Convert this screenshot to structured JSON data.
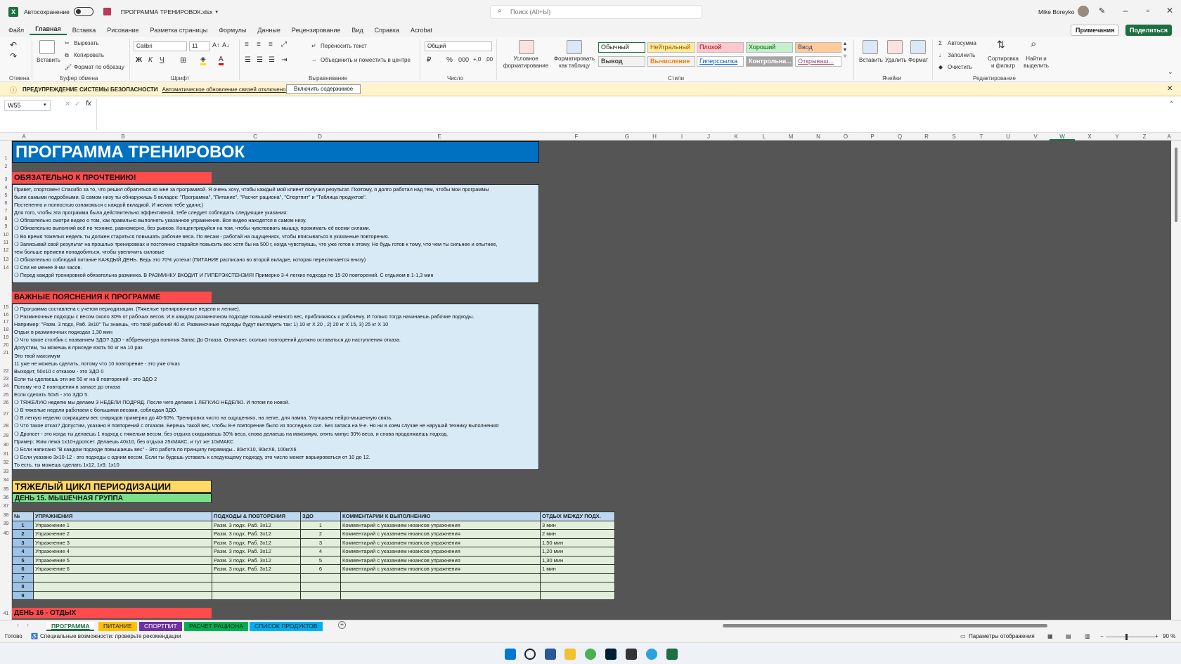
{
  "titlebar": {
    "autosave_label": "Автосохранение",
    "file_name": "ПРОГРАММА ТРЕНИРОВОК.xlsx",
    "search_placeholder": "Поиск (Alt+Ы)",
    "user_name": "Mike Boreyko"
  },
  "menu": {
    "tabs": [
      "Файл",
      "Главная",
      "Вставка",
      "Рисование",
      "Разметка страницы",
      "Формулы",
      "Данные",
      "Рецензирование",
      "Вид",
      "Справка",
      "Acrobat"
    ],
    "active_tab": "Главная",
    "comments": "Примечания",
    "share": "Поделиться"
  },
  "ribbon": {
    "groups": {
      "undo": "Отмена",
      "clipboard": "Буфер обмена",
      "font": "Шрифт",
      "alignment": "Выравнивание",
      "number": "Число",
      "styles": "Стили",
      "cells": "Ячейки",
      "editing": "Редактирование"
    },
    "paste": "Вставить",
    "cut": "Вырезать",
    "copy": "Копировать",
    "format_painter": "Формат по образцу",
    "font_name": "Calibri",
    "font_size": "11",
    "wrap_text": "Переносить текст",
    "merge_center": "Объединить и поместить в центре",
    "number_format": "Общий",
    "cond_format": "Условное форматирование",
    "format_table": "Форматировать как таблицу",
    "styles": [
      "Обычный",
      "Нейтральный",
      "Плохой",
      "Хороший",
      "Ввод",
      "Вывод",
      "Вычисление",
      "Гиперссылка",
      "Контрольна...",
      "Открываш..."
    ],
    "insert": "Вставить",
    "delete": "Удалить",
    "format": "Формат",
    "autosum": "Автосумма",
    "fill": "Заполнить",
    "clear": "Очистить",
    "sort_filter": "Сортировка и фильтр",
    "find_select": "Найти и выделить"
  },
  "warning": {
    "title": "ПРЕДУПРЕЖДЕНИЕ СИСТЕМЫ БЕЗОПАСНОСТИ",
    "message": "Автоматическое обновление связей отключено",
    "button": "Включить содержимое"
  },
  "formula_bar": {
    "name_box": "W55",
    "fx": "fx"
  },
  "columns": [
    "A",
    "B",
    "C",
    "D",
    "E",
    "F",
    "G",
    "H",
    "I",
    "J",
    "K",
    "L",
    "M",
    "N",
    "O",
    "P",
    "Q",
    "R",
    "S",
    "T",
    "U",
    "V",
    "W",
    "X",
    "Y",
    "Z",
    "A"
  ],
  "rows": [
    "1",
    "2",
    "3",
    "4",
    "5",
    "6",
    "7",
    "8",
    "9",
    "10",
    "11",
    "12",
    "13",
    "14",
    "15",
    "16",
    "17",
    "18",
    "19",
    "20",
    "21",
    "22",
    "23",
    "24",
    "25",
    "26",
    "27",
    "28",
    "29",
    "30",
    "31",
    "32",
    "33",
    "34",
    "35",
    "36",
    "37",
    "38",
    "39",
    "40",
    "41"
  ],
  "sheet": {
    "title": "ПРОГРАММА ТРЕНИРОВОК",
    "must_read": "ОБЯЗАТЕЛЬНО К ПРОЧТЕНИЮ!",
    "intro_lines": [
      "Привет, спортсмен! Спасибо за то, что решил обратиться ко мне за программой. Я очень хочу, чтобы каждый мой клиент получил результат. Поэтому, я долго работал над тем, чтобы мои программы",
      "были самыми подробными. В самом низу ты обнаружишь 5 вкладок: \"Программа\", \"Питание\", \"Расчет рациона\", \"Спортпит\" и \"Таблица продуктов\".",
      "Постепенно и полностью ознакомься с каждой вкладкой. И желаю тебе удачи;)",
      "Для того, чтобы эта программа была действительно эффективной, тебе следует соблюдать следующие указания:",
      "❍ Обязательно смотри видео о том, как правильно выполнять указанное упражнение. Все видео находятся в самом низу.",
      "❍ Обязательно выполняй всё по технике, равномерно, без рывков. Концентрируйся на том, чтобы чувствовать мышцу, прожимать её всеми силами.",
      "❍ Во время тяжелых недель ты должен стараться повышать рабочие веса. По весам - работай на ощущениях, чтобы вписываться в указанные повторения.",
      "❍ Записывай свой результат на прошлых тренировках и постоянно старайся повысить вес хотя бы на 500 г, когда чувствуешь, что уже готов к этому. Но будь готов к тому, что чем ты сильнее и опытнее,",
      "тем больше времени понадобиться, чтобы увеличить силовые",
      "❍ Обязательно соблюдай питание КАЖДЫЙ ДЕНЬ. Ведь это 70% успеха! (ПИТАНИЕ расписано во второй вкладке, которая переключается внизу)",
      "❍ Спи не менее 8-ми часов.",
      "❍ Перед каждой тренировкой обязательна разминка. В РАЗМИНКУ ВХОДИТ И ГИПЕРЭКСТЕНЗИЯ! Примерно 3-4 легких подхода по 15-20 повторений. С отдыхом в 1-1,3 мин"
    ],
    "notes_title": "ВАЖНЫЕ ПОЯСНЕНИЯ К ПРОГРАММЕ",
    "notes_lines": [
      "❍ Программа составлена с учетом периодизации. (Тяжелые тренировочные недели и легкие).",
      "❍ Разминочные подходы с весом около 30% от рабочих весов. И в каждом разминочном подходе повышай немного вес, приближаясь к рабочему. И только тогда начинаешь рабочие подходы.",
      "Например: \"Разм. 3 подх, Раб. 3х10\" Ты знаешь, что твой рабочий 40 кг. Разминочные подходы будут выглядеть так: 1) 10 кг Х 20 , 2) 20 кг Х 15, 3) 25 кг Х 10",
      "Отдых в разминочных подходах 1,30 мин",
      "❍ Что такое столбик с названием ЗДО? ЗДО - аббревиатура понятия Запас До Отказа. Означает, сколько повторений должно оставаться до наступления отказа.",
      "Допустим, ты можешь в приседе взять 50 кг на 10 раз",
      "Это твой максимум",
      "11 уже не можешь сделать, потому что 10 повторение - это уже отказ",
      "Выходит, 50х10 с отказом - это ЗДО 0",
      "Если ты сделаешь эти же 50 кг на 8 повторений - это ЗДО 2",
      "Потому что 2 повторения в запасе до отказа",
      "Если сделать 50х5 - это ЗДО 5.",
      "❍ ТЯЖЕЛУЮ неделю мы делаем 3 НЕДЕЛИ ПОДРЯД. После чего делаем 1 ЛЕГКУЮ НЕДЕЛЮ. И потом по новой.",
      "❍ В тяжелые недели работаем с большими весами, соблюдая ЗДО.",
      "❍ В легкую неделю сокращаем вес снарядов примерно до 40-50%. Тренировка чисто на ощущениях, на легке, для пампа. Улучшаем нейро-мышечную связь.",
      "❍ Что такое отказ? Допустим, указано 8 повторений с отказом. Берешь такой вес, чтобы 8-е повторение было из последних сил. Без запаса на 9-е. Но ни в коем случае не нарушай технику выполнения!",
      "❍ Дропсет - это когда ты делаешь 1 подход с тяжелым весом, без отдыха скидываешь 30% веса, снова делаешь на максимум, опять минус 30% веса, и снова продолжаешь подход.",
      "Пример: Жим лежа 1х10+дропсет. Делаешь 40х10, без отдыха 25хМАКС, и тут же 10хМАКС",
      "❍ Если написано \"В каждом подходе повышаешь вес\" - Это работа по принципу пирамиды.. 80кгХ10, 90кгХ8, 100кгХ6",
      "❍ Если указано 3х10-12 - это подходы с одним весом. Если ты будешь уставать к следующему подходу, это число может варьироваться от 10 до 12.",
      "То есть, ты можешь сделать 1х12, 1х9, 1х10"
    ],
    "heavy_cycle": "ТЯЖЕЛЫЙ ЦИКЛ ПЕРИОДИЗАЦИИ",
    "day15": "ДЕНЬ 15. МЫШЕЧНАЯ ГРУППА",
    "table_headers": [
      "№",
      "УПРАЖНЕНИЯ",
      "ПОДХОДЫ & ПОВТОРЕНИЯ",
      "ЗДО",
      "КОММЕНТАРИИ К ВЫПОЛНЕНИЮ",
      "ОТДЫХ МЕЖДУ ПОДХ."
    ],
    "table_rows": [
      [
        "1",
        "Упражнение 1",
        "Разм. 3 подх. Раб. 3х12",
        "1",
        "Комментарий с указанием нюансов упражнения",
        "3 мин"
      ],
      [
        "2",
        "Упражнение 2",
        "Разм. 3 подх. Раб. 3х12",
        "2",
        "Комментарий с указанием нюансов упражнения",
        "2 мин"
      ],
      [
        "3",
        "Упражнение 3",
        "Разм. 3 подх. Раб. 3х12",
        "3",
        "Комментарий с указанием нюансов упражнения",
        "1,50 мин"
      ],
      [
        "4",
        "Упражнение 4",
        "Разм. 3 подх. Раб. 3х12",
        "4",
        "Комментарий с указанием нюансов упражнения",
        "1,20 мин"
      ],
      [
        "5",
        "Упражнение 5",
        "Разм. 3 подх. Раб. 3х12",
        "5",
        "Комментарий с указанием нюансов упражнения",
        "1,30 мин"
      ],
      [
        "6",
        "Упражнение 6",
        "Разм. 3 подх. Раб. 3х12",
        "6",
        "Комментарий с указанием нюансов упражнения",
        "1 мин"
      ],
      [
        "7",
        "",
        "",
        "",
        "",
        ""
      ],
      [
        "8",
        "",
        "",
        "",
        "",
        ""
      ],
      [
        "9",
        "",
        "",
        "",
        "",
        ""
      ]
    ],
    "day16": "ДЕНЬ 16 - ОТДЫХ"
  },
  "sheet_tabs": [
    "ПРОГРАММА",
    "ПИТАНИЕ",
    "СПОРТПИТ",
    "РАСЧЕТ РАЦИОНА",
    "СПИСОК ПРОДУКТОВ"
  ],
  "status": {
    "ready": "Готово",
    "accessibility": "Специальные возможности: проверьте рекомендации",
    "display_settings": "Параметры отображения",
    "zoom": "90 %"
  },
  "colors": {
    "excel_green": "#1d6f42",
    "title_blue": "#0070c0",
    "red_banner": "#ff4b4b",
    "yellow_banner": "#ffd966",
    "green_banner": "#7be08c"
  }
}
